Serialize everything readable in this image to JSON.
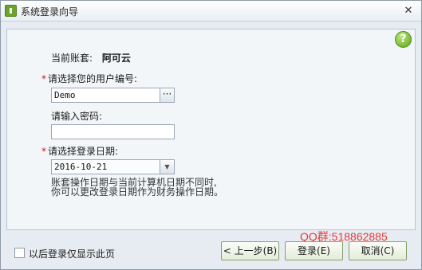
{
  "window": {
    "title": "系统登录向导",
    "close_glyph": "✕",
    "icon": "app-icon"
  },
  "help": {
    "glyph": "?",
    "icon": "help-icon"
  },
  "form": {
    "account_label": "当前账套:",
    "account_value": "阿可云",
    "required_mark": "*",
    "user_label": "请选择您的用户编号:",
    "user_value": "Demo",
    "user_browse_glyph": "···",
    "password_label": "请输入密码:",
    "password_value": "",
    "date_label": "请选择登录日期:",
    "date_value": "2016-10-21",
    "date_dropdown_glyph": "▼",
    "note_line1": "账套操作日期与当前计算机日期不同时,",
    "note_line2": "你可以更改登录日期作为财务操作日期。"
  },
  "footer": {
    "remember_label": "以后登录仅显示此页",
    "watermark": "QQ群:518862885",
    "prev_button": "< 上一步(B)",
    "login_button": "登录(E)",
    "cancel_button": "取消(C)"
  }
}
